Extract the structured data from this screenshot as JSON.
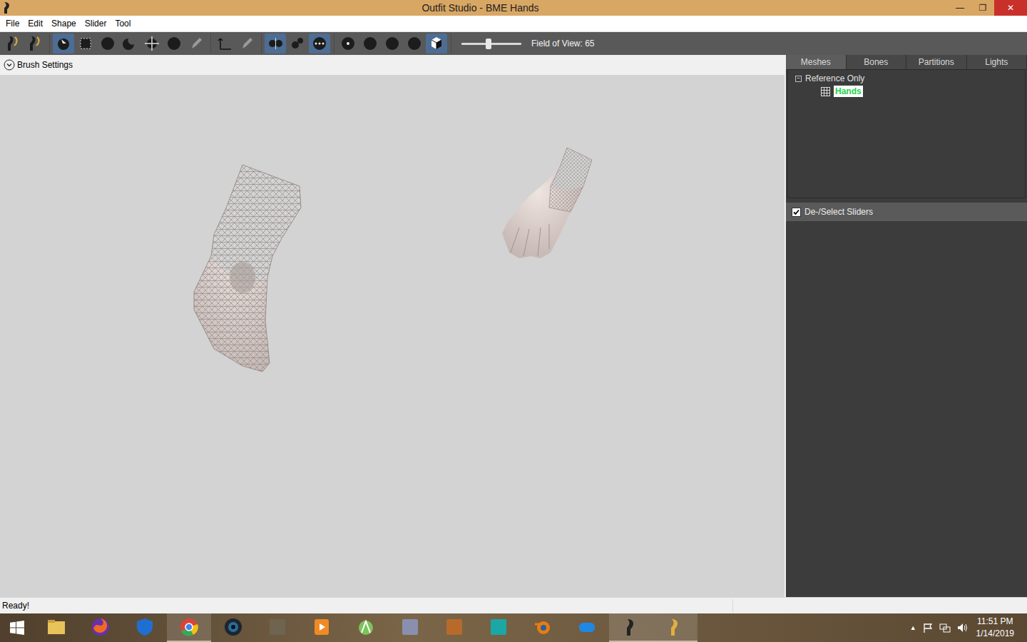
{
  "window": {
    "title": "Outfit Studio - BME Hands",
    "controls": [
      "—",
      "❐",
      "✕"
    ]
  },
  "menu": [
    "File",
    "Edit",
    "Shape",
    "Slider",
    "Tool"
  ],
  "toolbar": {
    "groups": [
      [
        {
          "kind": "logo",
          "selected": false
        },
        {
          "kind": "logo",
          "selected": false
        }
      ],
      [
        {
          "kind": "brush",
          "selected": true
        },
        {
          "kind": "square",
          "selected": false
        },
        {
          "kind": "ball",
          "selected": false
        },
        {
          "kind": "moon",
          "selected": false
        },
        {
          "kind": "move",
          "selected": false
        },
        {
          "kind": "ball",
          "selected": false
        },
        {
          "kind": "pen",
          "selected": false
        }
      ],
      [
        {
          "kind": "axis",
          "selected": false
        },
        {
          "kind": "pen",
          "selected": false
        }
      ],
      [
        {
          "kind": "mirror",
          "selected": true
        },
        {
          "kind": "dots",
          "selected": false
        },
        {
          "kind": "dots3",
          "selected": true
        }
      ],
      [
        {
          "kind": "small",
          "selected": false
        },
        {
          "kind": "ball",
          "selected": false
        },
        {
          "kind": "ball",
          "selected": false
        },
        {
          "kind": "ball",
          "selected": false
        },
        {
          "kind": "cube",
          "selected": true
        }
      ]
    ],
    "field_of_view": {
      "label": "Field of View: 65",
      "level": 0.45
    }
  },
  "brush_settings": {
    "label": "Brush Settings",
    "expanded": false
  },
  "tabs": [
    {
      "label": "Meshes",
      "selected": true
    },
    {
      "label": "Bones",
      "selected": false
    },
    {
      "label": "Partitions",
      "selected": false
    },
    {
      "label": "Lights",
      "selected": false
    }
  ],
  "tree": {
    "label": "Reference Only",
    "expanded": true,
    "toggle": "−",
    "children": [
      {
        "label": "Hands",
        "selected": true
      }
    ]
  },
  "sliders": {
    "label": "De-/Select Sliders",
    "checked": true
  },
  "status_bar": "Ready!",
  "taskbar": {
    "apps": [
      {
        "kind": "folder",
        "color": "#e8c35a",
        "open": false
      },
      {
        "kind": "fox",
        "color": "#f06a22",
        "open": false
      },
      {
        "kind": "shield",
        "color": "#1f6fd1",
        "open": false
      },
      {
        "kind": "chrome",
        "color": "#3aa757",
        "open": true
      },
      {
        "kind": "lens",
        "color": "#2b6d9a",
        "open": false
      },
      {
        "kind": "gimp",
        "color": "#6e6450",
        "open": false
      },
      {
        "kind": "play",
        "color": "#f08a24",
        "open": false
      },
      {
        "kind": "android",
        "color": "#7cc35b",
        "open": false
      },
      {
        "kind": "box",
        "color": "#8a8fb0",
        "open": false
      },
      {
        "kind": "anvil",
        "color": "#b86a2a",
        "open": false
      },
      {
        "kind": "max",
        "color": "#1aa7a6",
        "open": false
      },
      {
        "kind": "blender",
        "color": "#e87d0d",
        "open": false
      },
      {
        "kind": "link",
        "color": "#1e88e5",
        "open": false
      },
      {
        "kind": "logo",
        "color": "#222222",
        "open": true
      },
      {
        "kind": "logo",
        "color": "#e0b040",
        "open": true
      }
    ],
    "tray": {
      "chevron": "▲",
      "time": "11:51 PM",
      "date": "1/14/2019"
    }
  }
}
